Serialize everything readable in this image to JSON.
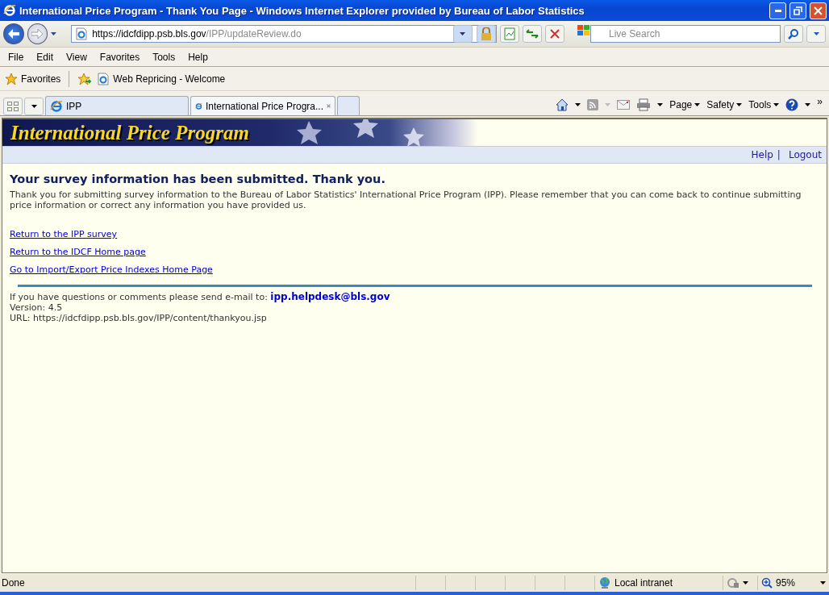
{
  "window": {
    "title": "International Price Program - Thank You Page - Windows Internet Explorer provided by Bureau of Labor Statistics"
  },
  "address_bar": {
    "host": "https://idcfdipp.psb.bls.gov",
    "path": "/IPP/updateReview.do"
  },
  "search": {
    "placeholder": "Live Search"
  },
  "menu": [
    "File",
    "Edit",
    "View",
    "Favorites",
    "Tools",
    "Help"
  ],
  "favorites_bar": {
    "label": "Favorites",
    "links": [
      "Web Repricing - Welcome"
    ]
  },
  "tabs": [
    {
      "label": "IPP",
      "selected": false
    },
    {
      "label": "International Price Progra...",
      "selected": true
    }
  ],
  "command_bar": {
    "menus": [
      "Page",
      "Safety",
      "Tools"
    ],
    "overflow": "»"
  },
  "page": {
    "banner": "International Price Program",
    "top_links": [
      "Help",
      "Logout"
    ],
    "link_separator": "|",
    "heading": "Your survey information has been submitted. Thank you.",
    "message": "Thank you for submitting survey information to the Bureau of Labor Statistics' International Price Program (IPP). Please remember that you can come back to continue submitting price information or correct any information you have provided us.",
    "links": [
      "Return to the IPP survey",
      "Return to the IDCF Home page",
      "Go to Import/Export Price Indexes Home Page"
    ],
    "contact_text": "If you have questions or comments please send e-mail to:",
    "contact_email": "ipp.helpdesk@bls.gov",
    "version": "Version: 4.5",
    "url": "URL: https://idcfdipp.psb.bls.gov/IPP/content/thankyou.jsp"
  },
  "status_bar": {
    "status": "Done",
    "zone": "Local intranet",
    "zoom": "95%"
  }
}
